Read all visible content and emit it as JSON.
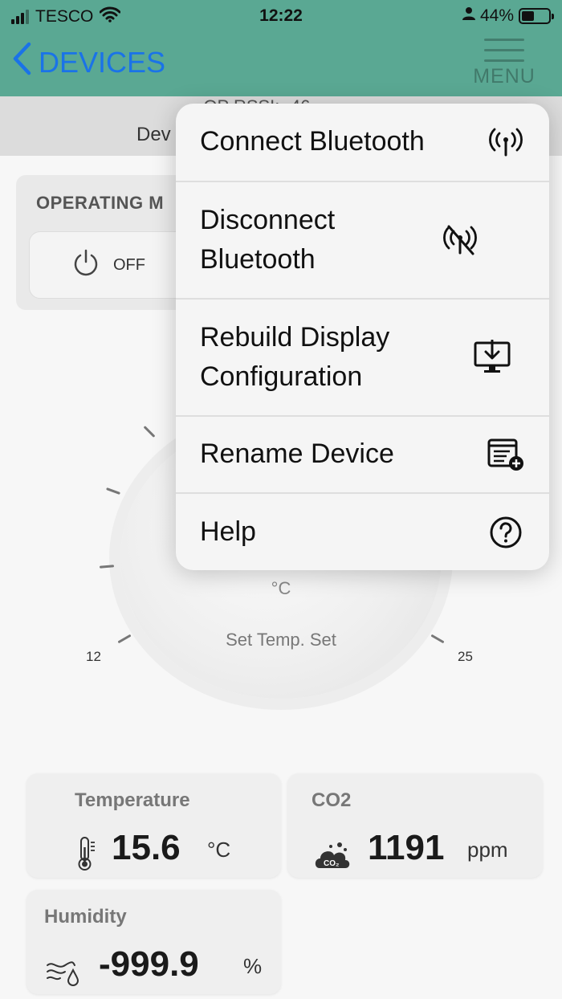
{
  "status_bar": {
    "carrier": "TESCO",
    "time": "12:22",
    "battery_percent": "44%",
    "battery_level": 0.44
  },
  "nav": {
    "back_label": "DEVICES",
    "menu_label": "MENU"
  },
  "device_bar": {
    "rssi_text": "- OP  RSSI: -46",
    "device_text": "Dev"
  },
  "operating_mode": {
    "title": "OPERATING M",
    "button_label": "OFF",
    "button_icon": "power-icon"
  },
  "setpoint_dial": {
    "unit": "°C",
    "label": "Set Temp. Set",
    "scale_min": "12",
    "scale_max": "25"
  },
  "metrics": {
    "temperature": {
      "title": "Temperature",
      "value": "15.6",
      "unit": "°C",
      "icon": "thermometer-icon"
    },
    "co2": {
      "title": "CO2",
      "value": "1191",
      "unit": "ppm",
      "icon": "co2-cloud-icon"
    },
    "humidity": {
      "title": "Humidity",
      "value": "-999.9",
      "unit": "%",
      "icon": "humidity-icon"
    }
  },
  "popup_menu": {
    "items": [
      {
        "label": "Connect Bluetooth",
        "icon": "antenna-icon"
      },
      {
        "label": "Disconnect Bluetooth",
        "icon": "antenna-off-icon"
      },
      {
        "label": "Rebuild Display Configuration",
        "icon": "display-download-icon"
      },
      {
        "label": "Rename Device",
        "icon": "rename-device-icon"
      },
      {
        "label": "Help",
        "icon": "help-icon"
      }
    ]
  },
  "colors": {
    "header": "#5aa893",
    "accent_blue": "#1a73e8",
    "popup_bg": "#f5f5f5"
  }
}
